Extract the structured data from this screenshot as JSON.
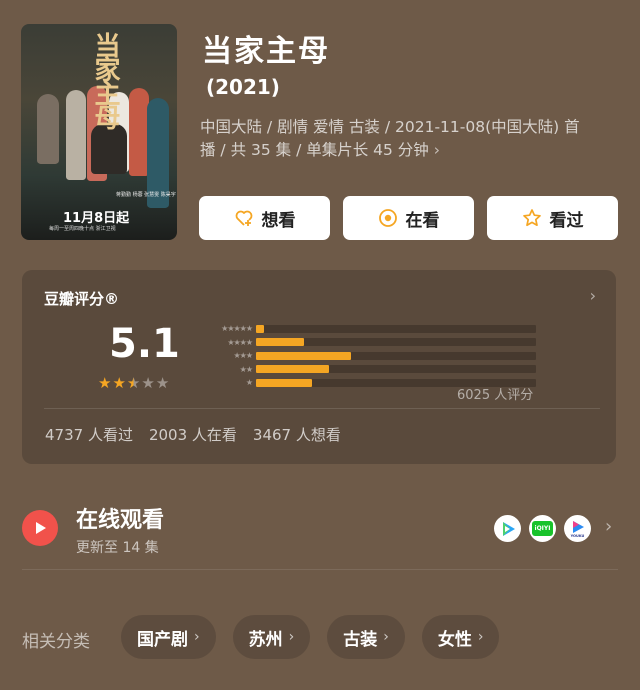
{
  "show": {
    "title": "当家主母",
    "year": "(2021)",
    "meta_line1": "中国大陆 / 剧情 爱情 古装 / 2021-11-08(中国大陆) 首",
    "meta_line2": "播 / 共 35 集 / 单集片长 45 分钟",
    "chevron": "›"
  },
  "poster": {
    "title_text": "当家主母",
    "date_text": "11月8日起",
    "small_text_1": "蒋勤勤 杨蓉 张慧雯 陈昊宇",
    "small_text_2": "每周一至周四晚十点 浙江卫视"
  },
  "actions": [
    {
      "label": "想看",
      "icon": "heart-plus-icon"
    },
    {
      "label": "在看",
      "icon": "target-icon"
    },
    {
      "label": "看过",
      "icon": "star-outline-icon"
    }
  ],
  "rating": {
    "label": "豆瓣评分®",
    "score": "5.1",
    "stars_value": 2.5,
    "distribution": [
      {
        "stars": "★★★★★",
        "percent": 3
      },
      {
        "stars": "★★★★",
        "percent": 17
      },
      {
        "stars": "★★★",
        "percent": 34
      },
      {
        "stars": "★★",
        "percent": 26
      },
      {
        "stars": "★",
        "percent": 20
      }
    ],
    "count_text": "6025 人评分",
    "stats": [
      "4737 人看过",
      "2003 人在看",
      "3467 人想看"
    ]
  },
  "online": {
    "title": "在线观看",
    "subtitle": "更新至 14 集",
    "platforms": [
      "tencent-video-icon",
      "iqiyi-icon",
      "youku-icon"
    ],
    "iqiyi_text": "iQIYI",
    "youku_text": "YOUKU"
  },
  "related": {
    "label": "相关分类",
    "chips": [
      "国产剧",
      "苏州",
      "古装",
      "女性"
    ]
  },
  "colors": {
    "background": "#6e5a48",
    "accent_star": "#f5a623",
    "play_red": "#f1524b"
  }
}
